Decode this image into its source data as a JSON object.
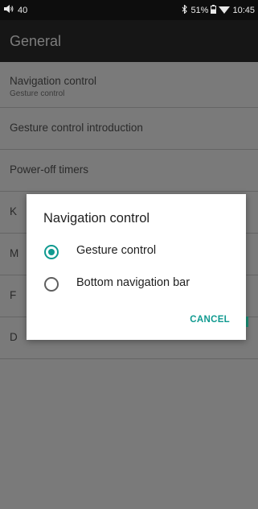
{
  "status_bar": {
    "volume_value": "40",
    "battery": "51%",
    "time": "10:45",
    "icons": [
      "volume-icon",
      "bluetooth-icon",
      "battery-icon",
      "wifi-icon"
    ]
  },
  "app_bar": {
    "title": "General"
  },
  "settings": {
    "items": [
      {
        "title": "Navigation control",
        "summary": "Gesture control"
      },
      {
        "title": "Gesture control introduction"
      },
      {
        "title": "Power-off timers"
      },
      {
        "title_visible": "K"
      },
      {
        "title_visible": "M"
      },
      {
        "title_visible": "F"
      },
      {
        "title_visible": "D"
      }
    ]
  },
  "dialog": {
    "title": "Navigation control",
    "options": [
      {
        "label": "Gesture control",
        "selected": true
      },
      {
        "label": "Bottom navigation bar",
        "selected": false
      }
    ],
    "cancel_label": "CANCEL",
    "accent_color": "#109a90"
  }
}
